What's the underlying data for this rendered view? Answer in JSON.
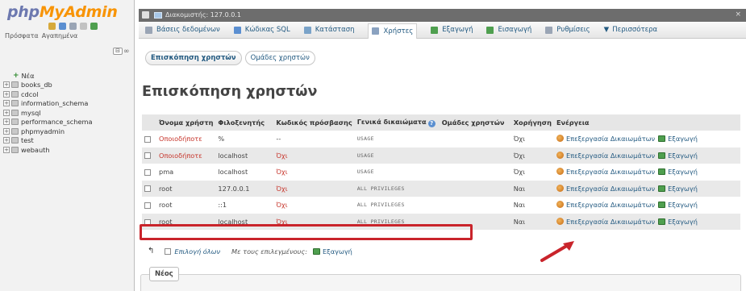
{
  "navigation": {
    "logo_php": "php",
    "logo_myadmin": "MyAdmin",
    "tabs": [
      "Πρόσφατα",
      "Αγαπημένα"
    ],
    "link_icon": "link-icon",
    "tree": [
      {
        "label": "Νέα",
        "type": "new"
      },
      {
        "label": "books_db",
        "type": "db"
      },
      {
        "label": "cdcol",
        "type": "db"
      },
      {
        "label": "information_schema",
        "type": "db"
      },
      {
        "label": "mysql",
        "type": "db"
      },
      {
        "label": "performance_schema",
        "type": "db"
      },
      {
        "label": "phpmyadmin",
        "type": "db"
      },
      {
        "label": "test",
        "type": "db"
      },
      {
        "label": "webauth",
        "type": "db"
      }
    ]
  },
  "serverbar": {
    "text": "Διακομιστής: 127.0.0.1"
  },
  "tabs": [
    {
      "label": "Βάσεις δεδομένων",
      "icon": "database-icon",
      "color": "#9aa5b5"
    },
    {
      "label": "Κώδικας SQL",
      "icon": "sql-icon",
      "color": "#5b8fd1"
    },
    {
      "label": "Κατάσταση",
      "icon": "status-icon",
      "color": "#7aa3c9"
    },
    {
      "label": "Χρήστες",
      "icon": "users-icon",
      "color": "#8aa2c0",
      "active": true
    },
    {
      "label": "Εξαγωγή",
      "icon": "export-icon",
      "color": "#4f9f4f"
    },
    {
      "label": "Εισαγωγή",
      "icon": "import-icon",
      "color": "#4f9f4f"
    },
    {
      "label": "Ρυθμίσεις",
      "icon": "settings-icon",
      "color": "#9aa5b5"
    },
    {
      "label": "Περισσότερα",
      "icon": "more-icon",
      "color": "#235a81"
    }
  ],
  "subtabs": [
    "Επισκόπηση χρηστών",
    "Ομάδες χρηστών"
  ],
  "page_title": "Επισκόπηση χρηστών",
  "table": {
    "headers": [
      "Όνομα χρήστη",
      "Φιλοξενητής",
      "Κωδικός πρόσβασης",
      "Γενικά δικαιώματα",
      "Ομάδες χρηστών",
      "Χορήγηση",
      "Ενέργεια"
    ],
    "edit_label": "Επεξεργασία Δικαιωμάτων",
    "export_label": "Εξαγωγή",
    "rows": [
      {
        "user": "Οποιοδήποτε",
        "host": "%",
        "password": "--",
        "privileges": "USAGE",
        "group": "",
        "grant": "Όχι",
        "user_red": true,
        "pwd_red": false
      },
      {
        "user": "Οποιοδήποτε",
        "host": "localhost",
        "password": "Όχι",
        "privileges": "USAGE",
        "group": "",
        "grant": "Όχι",
        "user_red": true,
        "pwd_red": true
      },
      {
        "user": "pma",
        "host": "localhost",
        "password": "Όχι",
        "privileges": "USAGE",
        "group": "",
        "grant": "Όχι",
        "user_red": false,
        "pwd_red": true
      },
      {
        "user": "root",
        "host": "127.0.0.1",
        "password": "Όχι",
        "privileges": "ALL PRIVILEGES",
        "group": "",
        "grant": "Ναι",
        "user_red": false,
        "pwd_red": true
      },
      {
        "user": "root",
        "host": "::1",
        "password": "Όχι",
        "privileges": "ALL PRIVILEGES",
        "group": "",
        "grant": "Ναι",
        "user_red": false,
        "pwd_red": true
      },
      {
        "user": "root",
        "host": "localhost",
        "password": "Όχι",
        "privileges": "ALL PRIVILEGES",
        "group": "",
        "grant": "Ναι",
        "user_red": false,
        "pwd_red": true
      }
    ],
    "highlight_color": "#c9242b"
  },
  "bottom_actions": {
    "select_all": "Επιλογή όλων",
    "with_selected": "Με τους επιλεγμένους:",
    "export": "Εξαγωγή"
  },
  "new_section": {
    "legend": "Νέος"
  }
}
